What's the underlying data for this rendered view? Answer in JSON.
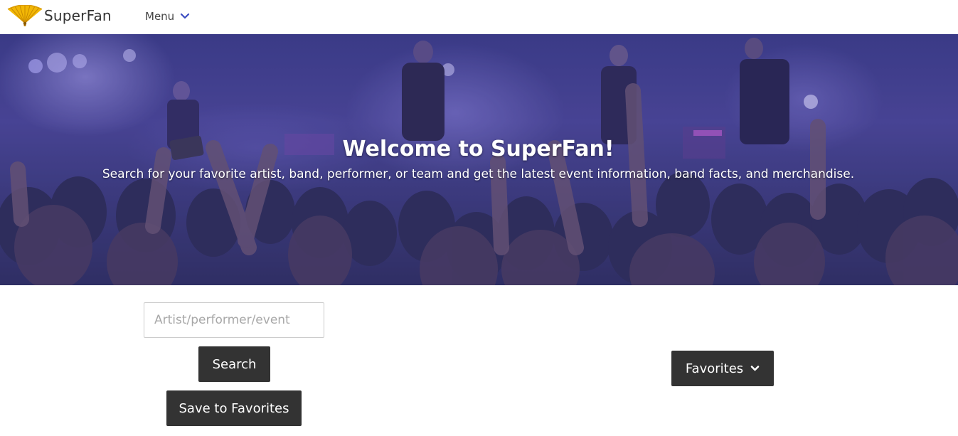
{
  "navbar": {
    "brand_name": "SuperFan",
    "logo_icon": "fan-icon",
    "menu_label": "Menu",
    "menu_icon": "chevron-down-icon",
    "accent_color": "#3b4cc0",
    "logo_color": "#f0b400"
  },
  "hero": {
    "title": "Welcome to SuperFan!",
    "subtitle": "Search for your favorite artist, band, performer, or team and get the latest event information, band facts, and merchandise.",
    "background_color": "#4a4596"
  },
  "search": {
    "placeholder": "Artist/performer/event",
    "value": "",
    "search_button": "Search",
    "save_button": "Save to Favorites"
  },
  "favorites": {
    "label": "Favorites",
    "icon": "chevron-down-icon",
    "button_color": "#333333"
  }
}
